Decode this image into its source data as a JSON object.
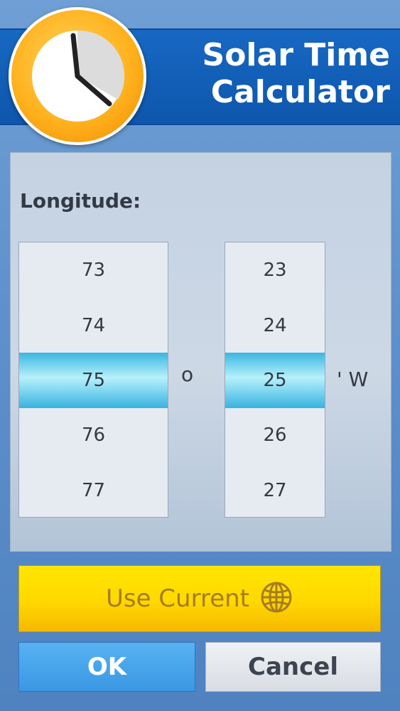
{
  "app": {
    "title_line1": "Solar Time",
    "title_line2": "Calculator"
  },
  "longitude": {
    "label": "Longitude:",
    "degrees": {
      "values": [
        "73",
        "74",
        "75",
        "76",
        "77"
      ],
      "selected": "75",
      "unit": "o"
    },
    "minutes": {
      "values": [
        "23",
        "24",
        "25",
        "26",
        "27"
      ],
      "selected": "25",
      "unit": "' W"
    }
  },
  "buttons": {
    "use_current": "Use Current",
    "ok": "OK",
    "cancel": "Cancel"
  },
  "icons": {
    "logo": "clock-icon",
    "use_current": "globe-icon"
  },
  "colors": {
    "header": "#1768c2",
    "selected_row": "#9fe6f8",
    "use_current_bg": "#ffd800",
    "ok_bg": "#3a97e2"
  }
}
